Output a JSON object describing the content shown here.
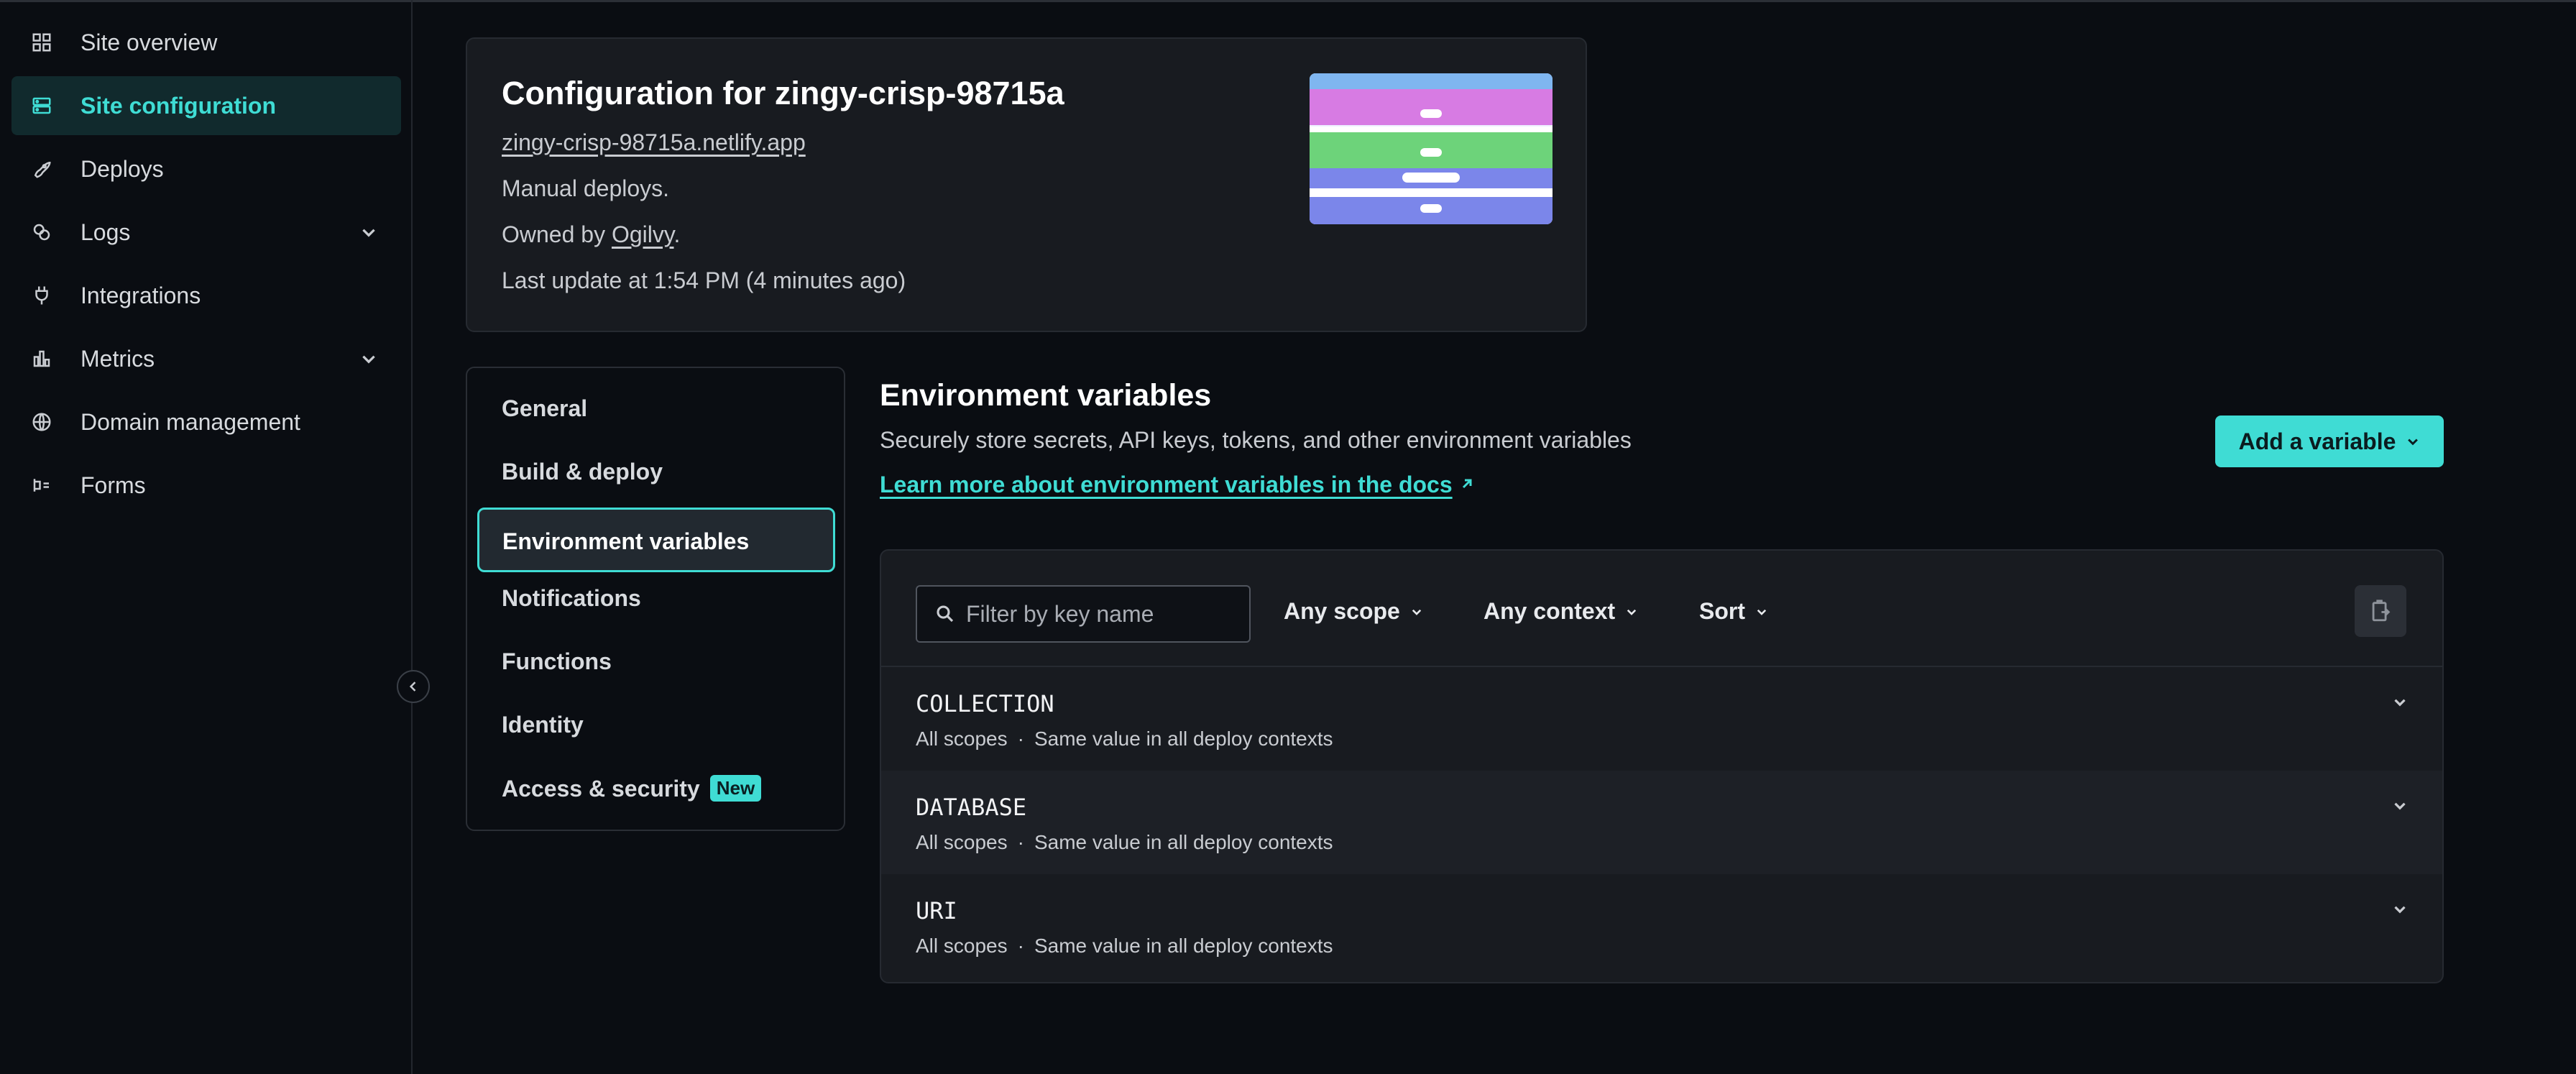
{
  "sidebar": {
    "items": [
      {
        "label": "Site overview",
        "icon": "grid-icon"
      },
      {
        "label": "Site configuration",
        "icon": "server-icon",
        "active": true
      },
      {
        "label": "Deploys",
        "icon": "rocket-icon"
      },
      {
        "label": "Logs",
        "icon": "logs-icon",
        "expandable": true
      },
      {
        "label": "Integrations",
        "icon": "plug-icon"
      },
      {
        "label": "Metrics",
        "icon": "bar-chart-icon",
        "expandable": true
      },
      {
        "label": "Domain management",
        "icon": "globe-icon"
      },
      {
        "label": "Forms",
        "icon": "forms-icon"
      }
    ]
  },
  "site": {
    "title": "Configuration for zingy-crisp-98715a",
    "url": "zingy-crisp-98715a.netlify.app",
    "deploy_mode": "Manual deploys.",
    "owner_prefix": "Owned by ",
    "owner": "Ogilvy",
    "owner_suffix": ".",
    "last_update": "Last update at 1:54 PM (4 minutes ago)"
  },
  "settings_nav": {
    "items": [
      "General",
      "Build & deploy",
      "Environment variables",
      "Notifications",
      "Functions",
      "Identity",
      "Access & security"
    ],
    "active": "Environment variables",
    "new_badge": "New"
  },
  "env": {
    "title": "Environment variables",
    "description": "Securely store secrets, API keys, tokens, and other environment variables",
    "docs_link": "Learn more about environment variables in the docs",
    "add_button": "Add a variable",
    "filter_placeholder": "Filter by key name",
    "scope_dropdown": "Any scope",
    "context_dropdown": "Any context",
    "sort_dropdown": "Sort",
    "variables": [
      {
        "key": "COLLECTION",
        "scope": "All scopes",
        "context": "Same value in all deploy contexts"
      },
      {
        "key": "DATABASE",
        "scope": "All scopes",
        "context": "Same value in all deploy contexts"
      },
      {
        "key": "URI",
        "scope": "All scopes",
        "context": "Same value in all deploy contexts"
      }
    ]
  },
  "colors": {
    "accent": "#3fdcd4",
    "background": "#0a0d12",
    "card": "#181b20"
  }
}
